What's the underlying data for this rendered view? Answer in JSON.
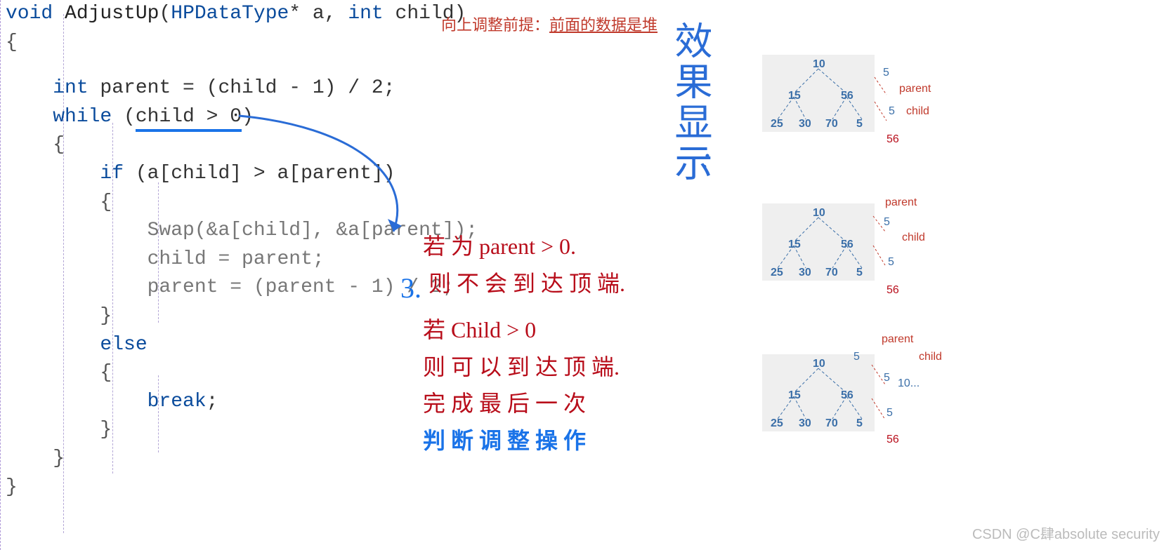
{
  "code": {
    "l1a": "void",
    "l1b": " AdjustUp",
    "l1c": "(",
    "l1d": "HPDataType",
    "l1e": "* a, ",
    "l1f": "int",
    "l1g": " child)",
    "l2": "{",
    "l3a": "    int",
    "l3b": " parent = (child - 1) / 2;",
    "l4a": "    while ",
    "l4b": "(",
    "l4c": "child > 0",
    "l4d": ")",
    "l5": "    {",
    "l6a": "        if ",
    "l6b": "(a[child] > a[parent])",
    "l7": "        {",
    "l8": "            Swap(&a[child], &a[parent]);",
    "l9": "            child = parent;",
    "l10": "            parent = (parent - 1) / 2;",
    "l11": "        }",
    "l12a": "        else",
    "l13": "        {",
    "l14a": "            break",
    "l14b": ";",
    "l15": "        }",
    "l16": "    }",
    "l17": "}"
  },
  "header": {
    "prefix": "向上调整前提：",
    "underline": "前面的数据是堆"
  },
  "blue_vert": "效果显示",
  "notes": {
    "num": "3.",
    "l1": "若 为 parent > 0.",
    "l2": "则 不 会 到 达 顶 端.",
    "l3": "若 Child > 0",
    "l4": "则 可 以 到 达 顶 端.",
    "l5": "完 成 最 后 一 次",
    "l6": "判 断 调 整 操 作"
  },
  "trees": {
    "t1": {
      "root": "10",
      "l": "15",
      "r": "56",
      "ll": "25",
      "lr": "30",
      "rl": "70",
      "rr": "5",
      "sideTop": "5",
      "sideTopLabel": "parent",
      "sideBot": "5",
      "sideBotLabel": "child",
      "below": "56"
    },
    "t2": {
      "root": "10",
      "l": "15",
      "r": "56",
      "ll": "25",
      "lr": "30",
      "rl": "70",
      "rr": "5",
      "sideTopLabel": "parent",
      "sideTop": "5",
      "sideBotLabel": "child",
      "below": "56"
    },
    "t3": {
      "root": "10",
      "l": "15",
      "r": "56",
      "ll": "25",
      "lr": "30",
      "rl": "70",
      "rr": "5",
      "sideTopLabel": "parent",
      "sideTopNum": "5",
      "sideBotLabel": "child",
      "sideBotNum": "5",
      "rightExtra": "10...",
      "below": "56"
    }
  },
  "watermark": "CSDN @C肆absolute security"
}
